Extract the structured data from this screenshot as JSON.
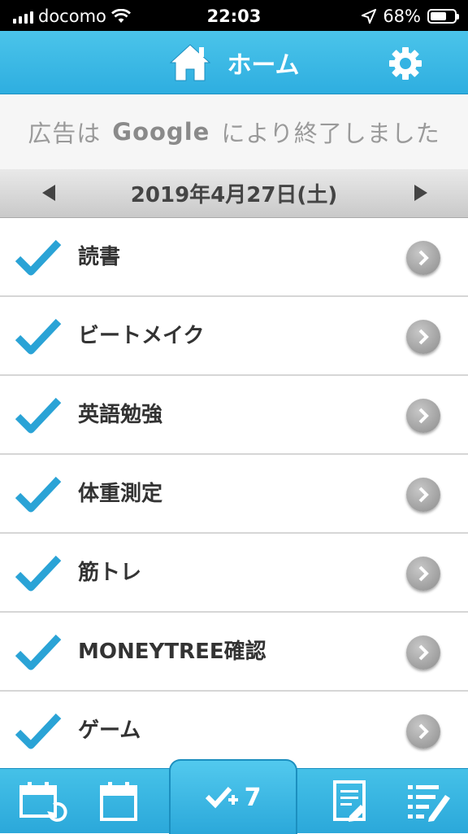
{
  "status": {
    "carrier": "docomo",
    "time": "22:03",
    "battery": "68%",
    "battery_level": 0.68
  },
  "nav": {
    "title": "ホーム"
  },
  "ad": {
    "prefix": "広告は",
    "brand": "Google",
    "suffix": "により終了しました"
  },
  "date": {
    "label": "2019年4月27日(土)"
  },
  "tasks": [
    {
      "label": "読書",
      "checked": true
    },
    {
      "label": "ビートメイク",
      "checked": true
    },
    {
      "label": "英語勉強",
      "checked": true
    },
    {
      "label": "体重測定",
      "checked": true
    },
    {
      "label": "筋トレ",
      "checked": true
    },
    {
      "label": "MONEYTREE確認",
      "checked": true
    },
    {
      "label": "ゲーム",
      "checked": true
    }
  ],
  "tabbar": {
    "done_count": "7"
  },
  "colors": {
    "accent": "#2eaee0",
    "check": "#2aa3d6"
  }
}
